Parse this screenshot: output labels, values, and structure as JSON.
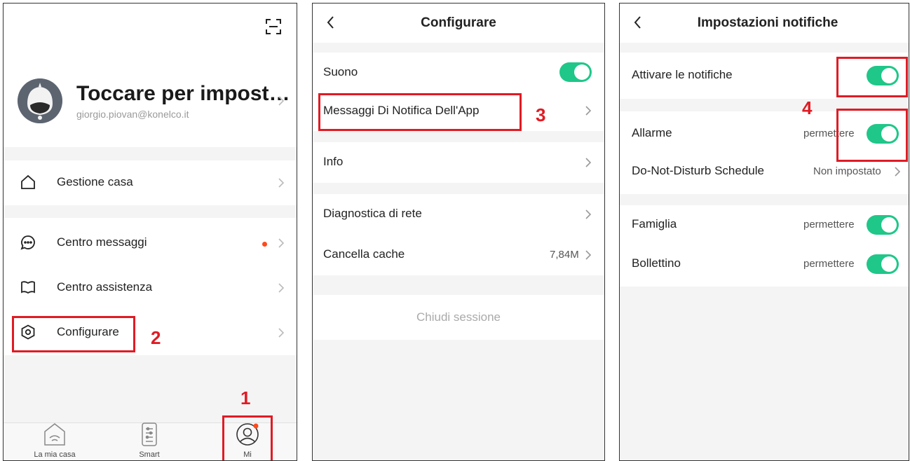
{
  "panel1": {
    "profile": {
      "name": "Toccare per impost…",
      "email": "giorgio.piovan@konelco.it"
    },
    "menu": {
      "gestione_casa": "Gestione casa",
      "centro_messaggi": "Centro messaggi",
      "centro_assistenza": "Centro assistenza",
      "configurare": "Configurare"
    },
    "tabs": {
      "home": "La mia casa",
      "smart": "Smart",
      "me": "Mi"
    },
    "annotations": {
      "one": "1",
      "two": "2"
    }
  },
  "panel2": {
    "title": "Configurare",
    "rows": {
      "suono": "Suono",
      "messaggi": "Messaggi Di Notifica Dell'App",
      "info": "Info",
      "diagnostica": "Diagnostica di rete",
      "cache": "Cancella cache",
      "cache_value": "7,84M"
    },
    "logout": "Chiudi sessione",
    "annotations": {
      "three": "3"
    }
  },
  "panel3": {
    "title": "Impostazioni notifiche",
    "rows": {
      "attivare": "Attivare le notifiche",
      "allarme": "Allarme",
      "allarme_value": "permettere",
      "dnd": "Do-Not-Disturb Schedule",
      "dnd_value": "Non impostato",
      "famiglia": "Famiglia",
      "famiglia_value": "permettere",
      "bollettino": "Bollettino",
      "bollettino_value": "permettere"
    },
    "annotations": {
      "four": "4"
    }
  },
  "colors": {
    "toggle_on": "#1fc789",
    "annotation": "#e01b24",
    "notification_dot": "#ff4a1c"
  }
}
